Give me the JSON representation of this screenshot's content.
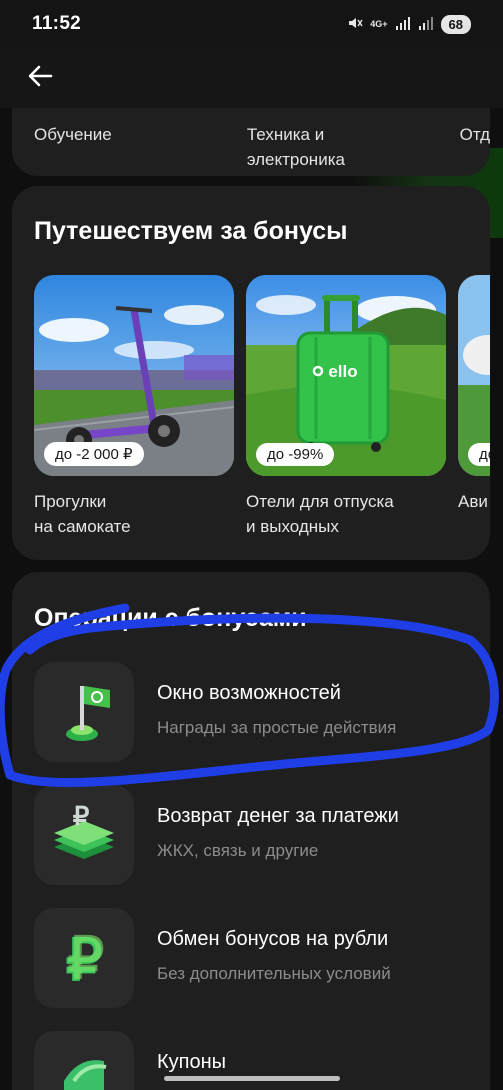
{
  "status_bar": {
    "time": "11:52",
    "network": "4G+",
    "battery": "68",
    "icons": [
      "mute-icon",
      "signal-icon",
      "signal-icon-2",
      "battery-icon"
    ]
  },
  "app_bar": {
    "back_icon": "arrow-left-icon"
  },
  "categories": {
    "items": [
      "Обучение",
      "Техника и\nэлектроника",
      "Отд"
    ]
  },
  "travel": {
    "title": "Путешествуем за бонусы",
    "tiles": [
      {
        "badge": "до -2 000 ₽",
        "caption": "Прогулки\nна самокате",
        "image": "scooter-image"
      },
      {
        "badge": "до -99%",
        "caption": "Отели для отпуска\nи выходных",
        "image": "suitcase-image",
        "suitcase_logo": "ello"
      },
      {
        "badge": "до",
        "caption": "Ави",
        "image": "plane-image"
      }
    ]
  },
  "operations": {
    "title": "Операции с бонусами",
    "items": [
      {
        "title": "Окно возможностей",
        "subtitle": "Награды за простые действия",
        "icon": "flag-icon"
      },
      {
        "title": "Возврат денег за платежи",
        "subtitle": "ЖКХ, связь и другие",
        "icon": "ruble-layers-icon"
      },
      {
        "title": "Обмен бонусов на рубли",
        "subtitle": "Без дополнительных условий",
        "icon": "ruble-icon"
      },
      {
        "title": "Купоны",
        "subtitle": "",
        "icon": "coupon-icon"
      }
    ]
  },
  "colors": {
    "background": "#0f0f0f",
    "card": "#1f1f1f",
    "accent_green": "#21a038",
    "annotation_blue": "#1f3ee6"
  }
}
